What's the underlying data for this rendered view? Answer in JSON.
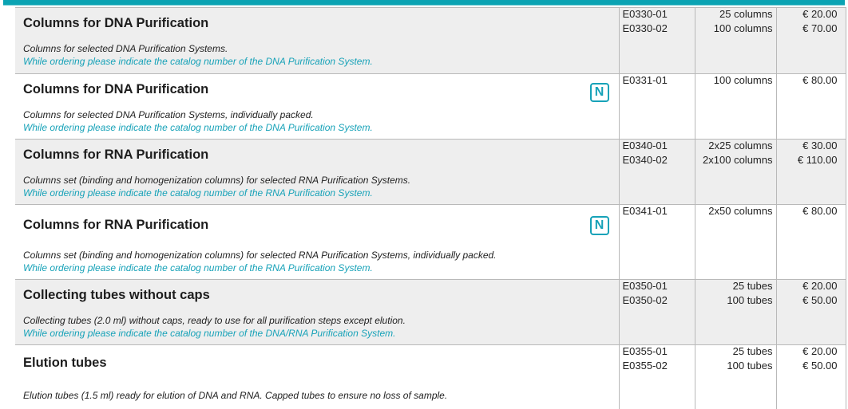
{
  "products": [
    {
      "title": "Columns for DNA Purification",
      "description": "Columns for selected DNA Purification Systems.",
      "note": "While ordering please indicate the catalog number of the DNA Purification System.",
      "new": false,
      "shaded": true,
      "items": [
        {
          "catalog": "E0330-01",
          "quantity": "25 columns",
          "price": "€ 20.00"
        },
        {
          "catalog": "E0330-02",
          "quantity": "100 columns",
          "price": "€ 70.00"
        }
      ]
    },
    {
      "title": "Columns for DNA Purification",
      "description": "Columns for selected DNA Purification Systems, individually packed.",
      "note": "While ordering please indicate the catalog number of the DNA Purification System.",
      "new": true,
      "shaded": false,
      "items": [
        {
          "catalog": "E0331-01",
          "quantity": "100 columns",
          "price": "€ 80.00"
        }
      ]
    },
    {
      "title": "Columns for RNA Purification",
      "description": "Columns set (binding and homogenization columns) for selected RNA Purification Systems.",
      "note": "While ordering please indicate the catalog number of the RNA Purification System.",
      "new": false,
      "shaded": true,
      "items": [
        {
          "catalog": "E0340-01",
          "quantity": "2x25 columns",
          "price": "€ 30.00"
        },
        {
          "catalog": "E0340-02",
          "quantity": "2x100 columns",
          "price": "€ 110.00"
        }
      ]
    },
    {
      "title": "Columns for RNA Purification",
      "description": "Columns set (binding and homogenization columns) for selected RNA Purification Systems, individually packed.",
      "note": "While ordering please indicate the catalog number of the RNA Purification System.",
      "new": true,
      "shaded": false,
      "items": [
        {
          "catalog": "E0341-01",
          "quantity": "2x50 columns",
          "price": "€ 80.00"
        }
      ]
    },
    {
      "title": "Collecting tubes without caps",
      "description": "Collecting tubes (2.0 ml) without caps, ready to use for all purification steps except elution.",
      "note": "While ordering please indicate the catalog number of the DNA/RNA Purification System.",
      "new": false,
      "shaded": true,
      "items": [
        {
          "catalog": "E0350-01",
          "quantity": "25 tubes",
          "price": "€ 20.00"
        },
        {
          "catalog": "E0350-02",
          "quantity": "100 tubes",
          "price": "€ 50.00"
        }
      ]
    },
    {
      "title": "Elution tubes",
      "description": "Elution tubes (1.5 ml) ready for elution of DNA and RNA. Capped tubes to ensure no loss of sample.",
      "note": "",
      "new": false,
      "shaded": false,
      "items": [
        {
          "catalog": "E0355-01",
          "quantity": "25 tubes",
          "price": "€ 20.00"
        },
        {
          "catalog": "E0355-02",
          "quantity": "100 tubes",
          "price": "€ 50.00"
        }
      ]
    }
  ],
  "badge_label": "N",
  "colors": {
    "accent": "#17a2b8",
    "shade": "#eeeeee",
    "border": "#b9b9b9"
  }
}
